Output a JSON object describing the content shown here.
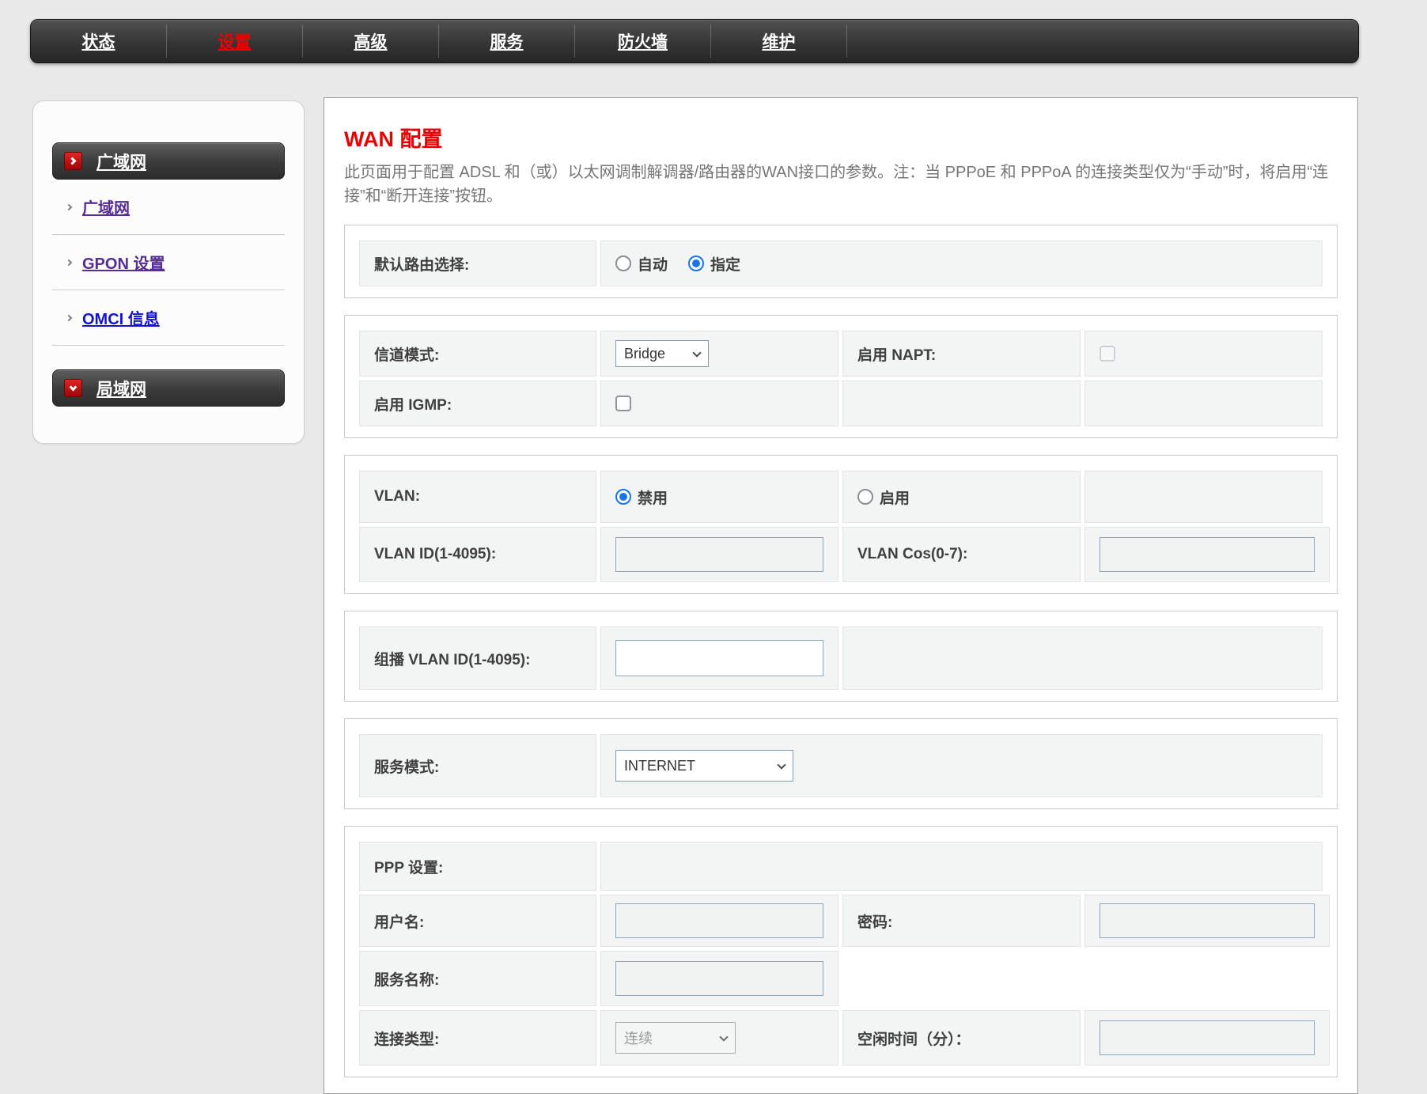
{
  "colors": {
    "accent_red": "#e60000",
    "nav_active_red": "#ee0000",
    "checked_blue": "#1a73e8",
    "visited_link_purple": "#552d90",
    "link_blue": "#1414cc"
  },
  "nav": {
    "items": [
      {
        "label": "状态",
        "active": false
      },
      {
        "label": "设置",
        "active": true
      },
      {
        "label": "高级",
        "active": false
      },
      {
        "label": "服务",
        "active": false
      },
      {
        "label": "防火墙",
        "active": false
      },
      {
        "label": "维护",
        "active": false
      }
    ]
  },
  "sidebar": {
    "wan_header": "广域网",
    "wan_links": [
      {
        "label": "广域网",
        "visited": true
      },
      {
        "label": "GPON 设置",
        "visited": true
      },
      {
        "label": "OMCI 信息",
        "visited": false
      }
    ],
    "lan_header": "局域网"
  },
  "content": {
    "title": "WAN 配置",
    "description": "此页面用于配置 ADSL 和（或）以太网调制解调器/路由器的WAN接口的参数。注：当 PPPoE 和 PPPoA 的连接类型仅为“手动”时，将启用“连接”和“断开连接”按钮。",
    "default_route": {
      "label": "默认路由选择:",
      "auto_label": "自动",
      "auto_checked": false,
      "specify_label": "指定",
      "specify_checked": true
    },
    "channel": {
      "mode_label": "信道模式:",
      "mode_value": "Bridge",
      "napt_label": "启用 NAPT:",
      "napt_checked": false,
      "igmp_label": "启用 IGMP:",
      "igmp_checked": false
    },
    "vlan": {
      "label": "VLAN:",
      "disable_label": "禁用",
      "disable_checked": true,
      "enable_label": "启用",
      "enable_checked": false,
      "id_label": "VLAN ID(1-4095):",
      "id_value": "",
      "cos_label": "VLAN Cos(0-7):",
      "cos_value": ""
    },
    "mcast": {
      "label": "组播 VLAN ID(1-4095):",
      "value": ""
    },
    "service": {
      "label": "服务模式:",
      "value": "INTERNET"
    },
    "ppp": {
      "settings_label": "PPP 设置:",
      "username_label": "用户名:",
      "username_value": "",
      "password_label": "密码:",
      "password_value": "",
      "service_name_label": "服务名称:",
      "service_name_value": "",
      "conn_type_label": "连接类型:",
      "conn_type_value": "连续",
      "idle_label": "空闲时间（分）：",
      "idle_value": ""
    }
  }
}
